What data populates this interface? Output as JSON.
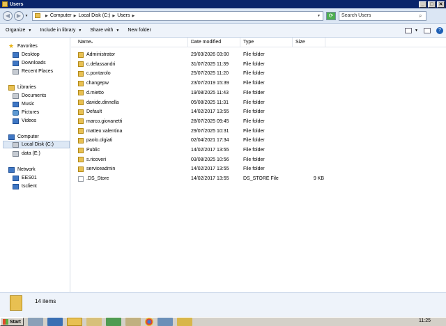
{
  "window": {
    "title": "Users",
    "min": "_",
    "max": "□",
    "close": "✕"
  },
  "address": {
    "crumbs": [
      "Computer",
      "Local Disk (C:)",
      "Users"
    ],
    "search_placeholder": "Search Users"
  },
  "toolbar": {
    "organize": "Organize",
    "include": "Include in library",
    "share": "Share with",
    "new_folder": "New folder"
  },
  "nav": {
    "favorites": "Favorites",
    "desktop": "Desktop",
    "downloads": "Downloads",
    "recent": "Recent Places",
    "libraries": "Libraries",
    "documents": "Documents",
    "music": "Music",
    "pictures": "Pictures",
    "videos": "Videos",
    "computer": "Computer",
    "local_disk": "Local Disk (C:)",
    "data_e": "data (E:)",
    "network": "Network",
    "ees01": "EES01",
    "tsclient": "tsclient"
  },
  "columns": {
    "name": "Name",
    "date": "Date modified",
    "type": "Type",
    "size": "Size"
  },
  "files": [
    {
      "name": "Administrator",
      "date": "29/03/2026 03:00",
      "type": "File folder",
      "size": ""
    },
    {
      "name": "c.delassandri",
      "date": "31/07/2025 11:39",
      "type": "File folder",
      "size": ""
    },
    {
      "name": "c.pontarolo",
      "date": "25/07/2025 11:20",
      "type": "File folder",
      "size": ""
    },
    {
      "name": "changepw",
      "date": "23/07/2019 15:39",
      "type": "File folder",
      "size": ""
    },
    {
      "name": "d.mietto",
      "date": "19/08/2025 11:43",
      "type": "File folder",
      "size": ""
    },
    {
      "name": "davide.dinnella",
      "date": "05/08/2025 11:31",
      "type": "File folder",
      "size": ""
    },
    {
      "name": "Default",
      "date": "14/02/2017 13:55",
      "type": "File folder",
      "size": ""
    },
    {
      "name": "marco.giovanetti",
      "date": "28/07/2025 09:45",
      "type": "File folder",
      "size": ""
    },
    {
      "name": "matteo.valentina",
      "date": "29/07/2025 10:31",
      "type": "File folder",
      "size": ""
    },
    {
      "name": "paolo.olgiati",
      "date": "02/04/2021 17:34",
      "type": "File folder",
      "size": ""
    },
    {
      "name": "Public",
      "date": "14/02/2017 13:55",
      "type": "File folder",
      "size": ""
    },
    {
      "name": "s.ricoveri",
      "date": "03/08/2025 10:56",
      "type": "File folder",
      "size": ""
    },
    {
      "name": "serviceadmin",
      "date": "14/02/2017 13:55",
      "type": "File folder",
      "size": ""
    },
    {
      "name": ".DS_Store",
      "date": "14/02/2017 13:55",
      "type": "DS_STORE File",
      "size": "9 KB"
    }
  ],
  "status": {
    "count": "14 items"
  },
  "taskbar": {
    "start": "Start",
    "clock": "11:25"
  }
}
